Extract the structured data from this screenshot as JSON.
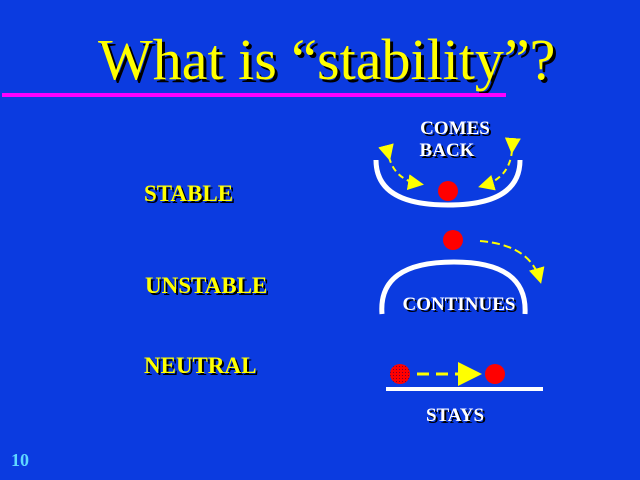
{
  "title": "What is “stability”?",
  "rows": [
    {
      "label": "STABLE",
      "caption": "COMES BACK"
    },
    {
      "label": "UNSTABLE",
      "caption": "CONTINUES"
    },
    {
      "label": "NEUTRAL",
      "caption": "STAYS"
    }
  ],
  "caption_lines": {
    "comes": "COMES",
    "back": "BACK"
  },
  "slide_number": "10",
  "colors": {
    "background": "#0b3be0",
    "title": "#ffff00",
    "rule": "#ff00ff",
    "ball": "#ff0000",
    "arrow": "#ffff00",
    "surface": "#ffffff"
  }
}
